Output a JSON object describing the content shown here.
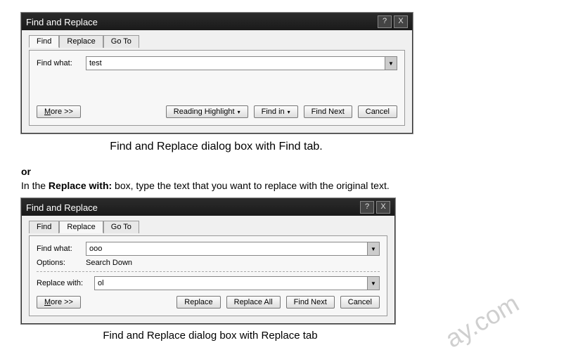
{
  "dialog1": {
    "title": "Find and Replace",
    "tabs": {
      "find": "Find",
      "replace": "Replace",
      "goto": "Go To"
    },
    "findWhatLabel": "Find what:",
    "findWhatValue": "test",
    "buttons": {
      "more": "More >>",
      "readingHighlight": "Reading Highlight",
      "findIn": "Find in",
      "findNext": "Find Next",
      "cancel": "Cancel"
    }
  },
  "caption1": "Find and Replace dialog box with Find tab.",
  "orText": "or",
  "instruction": {
    "pre": "In the ",
    "bold": "Replace with:",
    "post": " box, type the text that you want to replace with the original text."
  },
  "dialog2": {
    "title": "Find and Replace",
    "tabs": {
      "find": "Find",
      "replace": "Replace",
      "goto": "Go To"
    },
    "findWhatLabel": "Find what:",
    "findWhatValue": "ooo",
    "optionsLabel": "Options:",
    "optionsValue": "Search Down",
    "replaceWithLabel": "Replace with:",
    "replaceWithValue": "ol",
    "buttons": {
      "more": "More >>",
      "replace": "Replace",
      "replaceAll": "Replace All",
      "findNext": "Find Next",
      "cancel": "Cancel"
    }
  },
  "caption2": "Find and Replace dialog box with Replace tab",
  "titlebar": {
    "help": "?",
    "close": "X"
  },
  "watermark": "ay.com"
}
